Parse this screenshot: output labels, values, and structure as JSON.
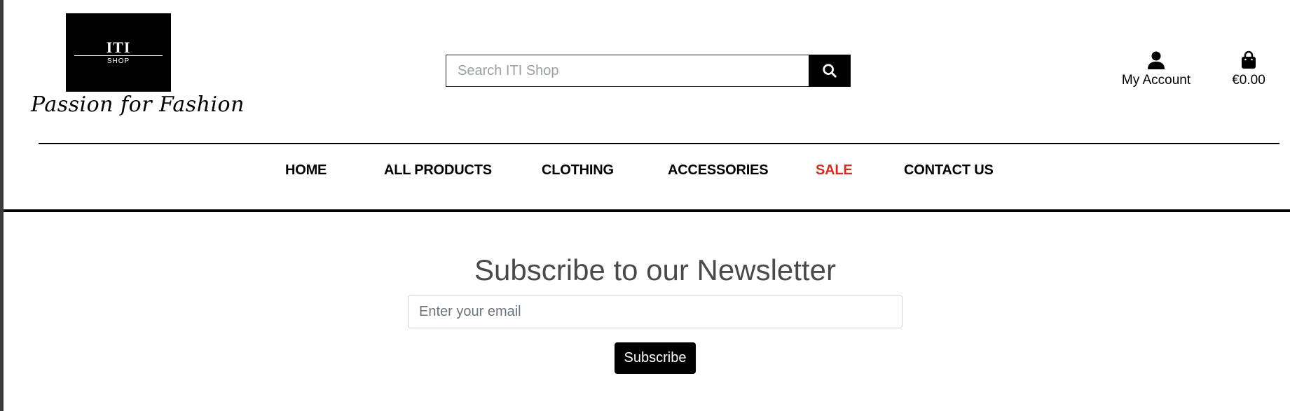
{
  "brand": {
    "logo_main": "ITI",
    "logo_sub": "SHOP",
    "tagline": "Passion for Fashion"
  },
  "search": {
    "placeholder": "Search ITI Shop",
    "button_icon": "search-icon"
  },
  "header_actions": {
    "account": {
      "label": "My Account",
      "icon": "user-icon"
    },
    "cart": {
      "label": "€0.00",
      "icon": "shopping-bag-icon"
    }
  },
  "nav": {
    "items": [
      {
        "label": "HOME"
      },
      {
        "label": "ALL PRODUCTS"
      },
      {
        "label": "CLOTHING"
      },
      {
        "label": "ACCESSORIES"
      },
      {
        "label": "SALE",
        "color": "#d32f1f"
      },
      {
        "label": "CONTACT US"
      }
    ]
  },
  "newsletter": {
    "title": "Subscribe to our Newsletter",
    "email_placeholder": "Enter your email",
    "button_label": "Subscribe"
  },
  "colors": {
    "accent": "#000000",
    "sale": "#d32f1f",
    "title_text": "#4a4a4a"
  }
}
